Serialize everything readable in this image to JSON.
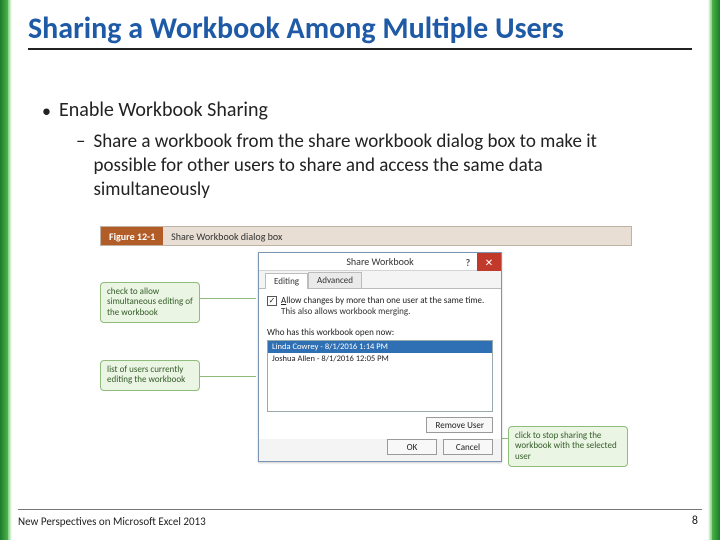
{
  "title": "Sharing a Workbook Among Multiple Users",
  "bullets": {
    "b1": "Enable Workbook Sharing",
    "b2": "Share a workbook from the share workbook dialog box to make it possible for other users to share and access the same data simultaneously"
  },
  "figure": {
    "num": "Figure 12-1",
    "caption": "Share Workbook dialog box"
  },
  "callouts": {
    "c1": "check to allow simultaneous editing of the workbook",
    "c2": "list of users currently editing the workbook",
    "c3": "click to stop sharing the workbook with the selected user"
  },
  "dialog": {
    "title": "Share Workbook",
    "help": "?",
    "close": "✕",
    "tabs": {
      "editing": "Editing",
      "advanced": "Advanced"
    },
    "checkbox": {
      "pre": "A",
      "mid": "llow changes by more than one user at the same time.",
      "note": "This also allows workbook merging."
    },
    "who_label": "Who has this workbook open now:",
    "users": [
      "Linda Cowrey - 8/1/2016 1:14 PM",
      "Joshua Allen - 8/1/2016 12:05 PM"
    ],
    "buttons": {
      "remove": "Remove User",
      "ok": "OK",
      "cancel": "Cancel"
    }
  },
  "footer": "New Perspectives on Microsoft Excel 2013",
  "page": "8"
}
